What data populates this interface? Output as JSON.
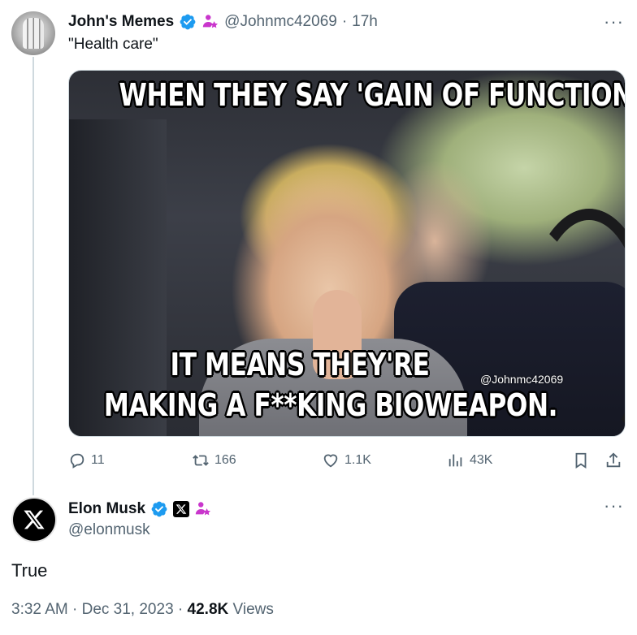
{
  "tweet": {
    "author_name": "John's Memes",
    "author_handle": "@Johnmc42069",
    "separator": "·",
    "time_ago": "17h",
    "text": "\"Health care\"",
    "media": {
      "caption_top": "WHEN THEY SAY 'GAIN OF FUNCTION'",
      "caption_mid": "IT MEANS THEY'RE",
      "caption_bottom": "MAKING A F**KING BIOWEAPON.",
      "watermark": "@Johnmc42069"
    },
    "actions": {
      "replies": "11",
      "retweets": "166",
      "likes": "1.1K",
      "views": "43K"
    }
  },
  "reply": {
    "author_name": "Elon Musk",
    "author_handle": "@elonmusk",
    "text": "True",
    "time": "3:32 AM",
    "date": "Dec 31, 2023",
    "separator": "·",
    "views_count": "42.8K",
    "views_label": "Views"
  },
  "more_label": "···",
  "colors": {
    "verified": "#1d9bf0",
    "affiliate": "#c936cc",
    "secondary_text": "#536471",
    "primary_text": "#0f1419"
  },
  "icons": [
    "verified-icon",
    "affiliate-icon",
    "x-badge-icon",
    "reply-icon",
    "retweet-icon",
    "like-icon",
    "views-icon",
    "bookmark-icon",
    "share-icon",
    "more-icon"
  ]
}
